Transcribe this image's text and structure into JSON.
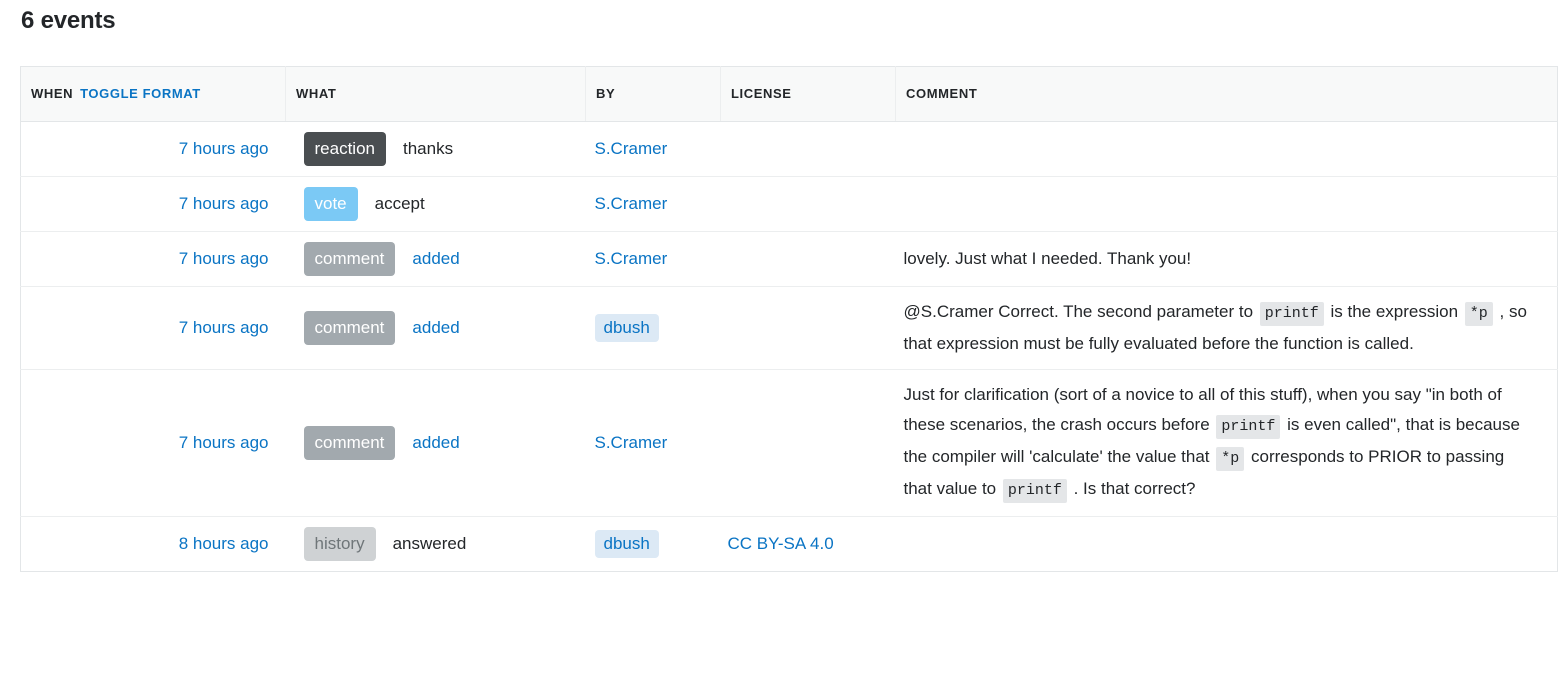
{
  "page": {
    "title": "6 events"
  },
  "table": {
    "headers": {
      "when": "WHEN",
      "toggle_format": "TOGGLE FORMAT",
      "what": "WHAT",
      "by": "BY",
      "license": "LICENSE",
      "comment": "COMMENT"
    },
    "colors": {
      "link": "#0a74c4",
      "badge_reaction_bg": "#4a4e51",
      "badge_vote_bg": "#7bc9f5",
      "badge_comment_bg": "#a2a9ae",
      "badge_history_bg": "#cfd2d4",
      "owner_chip_bg": "#dce9f5",
      "inline_code_bg": "#e4e6e8",
      "header_bg": "#f8f9f9",
      "border": "#e3e6e8"
    },
    "rows": [
      {
        "when": "7 hours ago",
        "badge": "reaction",
        "badge_type": "reaction",
        "what": "thanks",
        "what_is_link": false,
        "by": "S.Cramer",
        "by_is_chip": false,
        "license": "",
        "comment_parts": []
      },
      {
        "when": "7 hours ago",
        "badge": "vote",
        "badge_type": "vote",
        "what": "accept",
        "what_is_link": false,
        "by": "S.Cramer",
        "by_is_chip": false,
        "license": "",
        "comment_parts": []
      },
      {
        "when": "7 hours ago",
        "badge": "comment",
        "badge_type": "comment",
        "what": "added",
        "what_is_link": true,
        "by": "S.Cramer",
        "by_is_chip": false,
        "license": "",
        "comment_parts": [
          {
            "type": "text",
            "value": "lovely. Just what I needed. Thank you!"
          }
        ]
      },
      {
        "when": "7 hours ago",
        "badge": "comment",
        "badge_type": "comment",
        "what": "added",
        "what_is_link": true,
        "by": "dbush",
        "by_is_chip": true,
        "license": "",
        "comment_parts": [
          {
            "type": "text",
            "value": "@S.Cramer Correct. The second parameter to "
          },
          {
            "type": "code",
            "value": "printf"
          },
          {
            "type": "text",
            "value": " is the expression "
          },
          {
            "type": "code",
            "value": "*p"
          },
          {
            "type": "text",
            "value": " , so that expression must be fully evaluated before the function is called."
          }
        ]
      },
      {
        "when": "7 hours ago",
        "badge": "comment",
        "badge_type": "comment",
        "what": "added",
        "what_is_link": true,
        "by": "S.Cramer",
        "by_is_chip": false,
        "license": "",
        "comment_parts": [
          {
            "type": "text",
            "value": "Just for clarification (sort of a novice to all of this stuff), when you say \"in both of these scenarios, the crash occurs before "
          },
          {
            "type": "code",
            "value": "printf"
          },
          {
            "type": "text",
            "value": " is even called\", that is because the compiler will 'calculate' the value that "
          },
          {
            "type": "code",
            "value": "*p"
          },
          {
            "type": "text",
            "value": " corresponds to PRIOR to passing that value to "
          },
          {
            "type": "code",
            "value": "printf"
          },
          {
            "type": "text",
            "value": " . Is that correct?"
          }
        ]
      },
      {
        "when": "8 hours ago",
        "badge": "history",
        "badge_type": "history",
        "what": "answered",
        "what_is_link": false,
        "by": "dbush",
        "by_is_chip": true,
        "license": "CC BY-SA 4.0",
        "comment_parts": []
      }
    ]
  }
}
